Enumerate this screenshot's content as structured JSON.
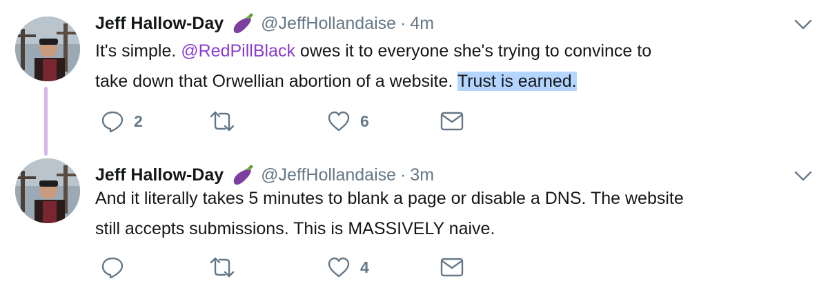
{
  "colors": {
    "text": "#14171a",
    "muted": "#657786",
    "mention": "#8a3bd0",
    "selection": "#b4d5fe",
    "thread_line": "#d6b6e8"
  },
  "tweets": [
    {
      "name": "Jeff Hallow-Day",
      "emoji": "eggplant-emoji",
      "handle": "@JeffHollandaise",
      "separator": "·",
      "time": "4m",
      "line1_pre": "It's simple. ",
      "mention": "@RedPillBlack",
      "line1_post": " owes it to everyone she's trying to convince to",
      "line2_pre": "take down that Orwellian abortion of a website. ",
      "line2_highlight": "Trust is earned.",
      "reply_count": "2",
      "retweet_count": "",
      "like_count": "6"
    },
    {
      "name": "Jeff Hallow-Day",
      "emoji": "eggplant-emoji",
      "handle": "@JeffHollandaise",
      "separator": "·",
      "time": "3m",
      "line1": "And it literally takes 5 minutes to blank a page or disable a DNS. The website",
      "line2": "still accepts submissions. This is MASSIVELY naive.",
      "reply_count": "",
      "retweet_count": "",
      "like_count": "4"
    }
  ]
}
